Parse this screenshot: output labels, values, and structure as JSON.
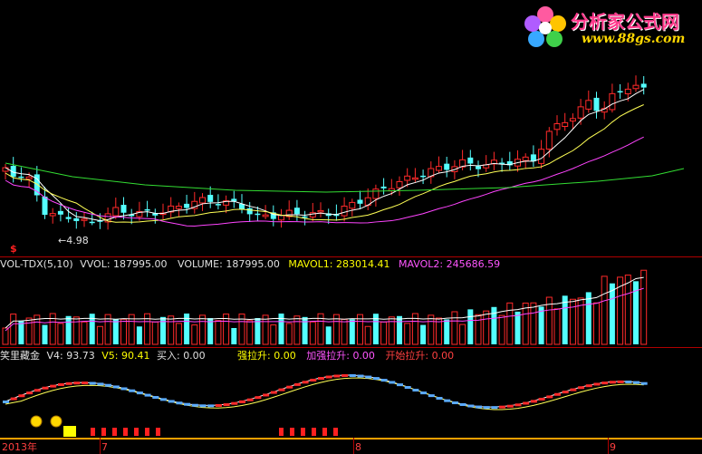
{
  "logo": {
    "title": "分析家公式网",
    "url": "www.88gs.com"
  },
  "price_pane": {
    "low_marker": "4.98",
    "currency_marker": "$"
  },
  "volume_pane": {
    "name": "VOL-TDX(5,10)",
    "vvol_label": "VVOL:",
    "vvol_value": "187995.00",
    "volume_label": "VOLUME:",
    "volume_value": "187995.00",
    "mavol1_label": "MAVOL1:",
    "mavol1_value": "283014.41",
    "mavol2_label": "MAVOL2:",
    "mavol2_value": "245686.59"
  },
  "indicator_pane": {
    "name": "笑里藏金",
    "v4_label": "V4:",
    "v4_value": "93.73",
    "v5_label": "V5:",
    "v5_value": "90.41",
    "buy_label": "买入:",
    "buy_value": "0.00",
    "strong_label": "强拉升:",
    "strong_value": "0.00",
    "stronger_label": "加强拉升:",
    "stronger_value": "0.00",
    "start_label": "开始拉升:",
    "start_value": "0.00"
  },
  "time_axis": {
    "labels": [
      "2013年",
      "7",
      "8",
      "9"
    ]
  },
  "colors": {
    "up": "#ff2a2a",
    "down": "#54ffff",
    "ma_fast": "#ffffff",
    "ma_mid": "#ffff55",
    "ma_slow": "#ff44ff",
    "ma_long": "#33dd33",
    "label_white": "#e0e0e0",
    "label_yellow": "#ffff00",
    "label_magenta": "#ff55ff",
    "label_red": "#ff4040",
    "frame": "#b00000"
  }
}
